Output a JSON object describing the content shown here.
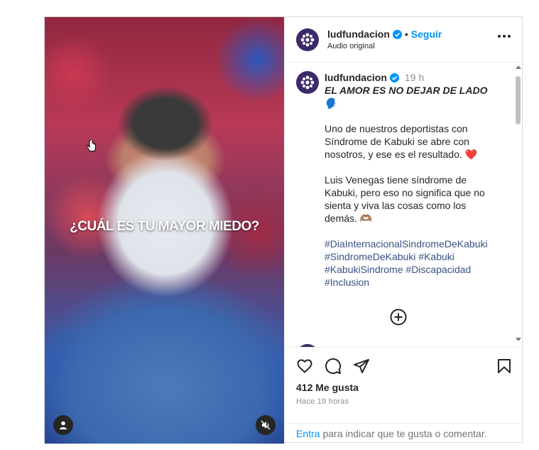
{
  "media": {
    "overlay_text": "¿CUÁL ES TU MAYOR MIEDO?"
  },
  "header": {
    "username": "ludfundacion",
    "dot": "•",
    "follow_label": "Seguir",
    "audio_label": "Audio original"
  },
  "caption": {
    "username": "ludfundacion",
    "time": "19 h",
    "title": "EL AMOR ES NO DEJAR DE LADO 🗣️",
    "paragraph1": "Uno de nuestros deportistas con Síndrome de Kabuki se abre con nosotros, y ese es el resultado. ❤️",
    "paragraph2": "Luis Venegas tiene síndrome de Kabuki, pero eso no significa que no sienta y viva las cosas como los demás. 🫶🏽",
    "hashtags": [
      "#DiaInternacionalSindromeDeKabuki",
      "#SindromeDeKabuki",
      "#Kabuki",
      "#KabukiSindrome",
      "#Discapacidad",
      "#Inclusion"
    ]
  },
  "actions": {
    "likes": "412 Me gusta",
    "time_ago": "Hace 19 horas"
  },
  "login": {
    "link": "Entra",
    "text": "para indicar que te gusta o comentar."
  },
  "colors": {
    "accent": "#0095f6",
    "hashtag": "#385185",
    "verified": "#0095f6"
  }
}
